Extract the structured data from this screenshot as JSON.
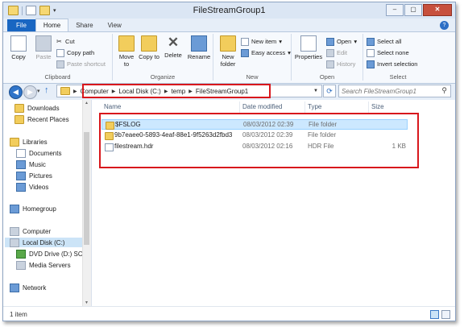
{
  "window": {
    "title": "FileStreamGroup1",
    "controls": [
      "–",
      "▢",
      "✕"
    ]
  },
  "ribbon": {
    "tabs": [
      "File",
      "Home",
      "Share",
      "View"
    ],
    "active_tab": "Home",
    "clipboard": {
      "copy": "Copy",
      "paste": "Paste",
      "cut": "Cut",
      "copy_path": "Copy path",
      "paste_shortcut": "Paste shortcut",
      "label": "Clipboard"
    },
    "organize": {
      "move_to": "Move to",
      "copy_to": "Copy to",
      "delete": "Delete",
      "rename": "Rename",
      "label": "Organize"
    },
    "new": {
      "new_folder": "New folder",
      "new_item": "New item",
      "easy_access": "Easy access",
      "label": "New"
    },
    "open": {
      "properties": "Properties",
      "open": "Open",
      "edit": "Edit",
      "history": "History",
      "label": "Open"
    },
    "select": {
      "select_all": "Select all",
      "select_none": "Select none",
      "invert": "Invert selection",
      "label": "Select"
    }
  },
  "address": {
    "crumbs": [
      "Computer",
      "Local Disk (C:)",
      "temp",
      "FileStreamGroup1"
    ],
    "search_placeholder": "Search FileStreamGroup1"
  },
  "nav": {
    "favorites": [
      "Downloads",
      "Recent Places"
    ],
    "libraries_header": "Libraries",
    "libraries": [
      "Documents",
      "Music",
      "Pictures",
      "Videos"
    ],
    "homegroup": "Homegroup",
    "computer_header": "Computer",
    "drives": [
      "Local Disk (C:)",
      "DVD Drive (D:) SC",
      "Media Servers"
    ],
    "network": "Network"
  },
  "columns": {
    "name": "Name",
    "date": "Date modified",
    "type": "Type",
    "size": "Size"
  },
  "files": [
    {
      "name": "$FSLOG",
      "date": "08/03/2012 02:39",
      "type": "File folder",
      "size": "",
      "kind": "folder"
    },
    {
      "name": "9b7eaee0-5893-4eaf-88e1-9f5263d2fbd3",
      "date": "08/03/2012 02:39",
      "type": "File folder",
      "size": "",
      "kind": "folder"
    },
    {
      "name": "filestream.hdr",
      "date": "08/03/2012 02:16",
      "type": "HDR File",
      "size": "1 KB",
      "kind": "file"
    }
  ],
  "status": {
    "count": "1 item"
  },
  "colors": {
    "accent": "#1966c2",
    "highlight_box": "#d8171c",
    "selection": "#cce8ff"
  }
}
